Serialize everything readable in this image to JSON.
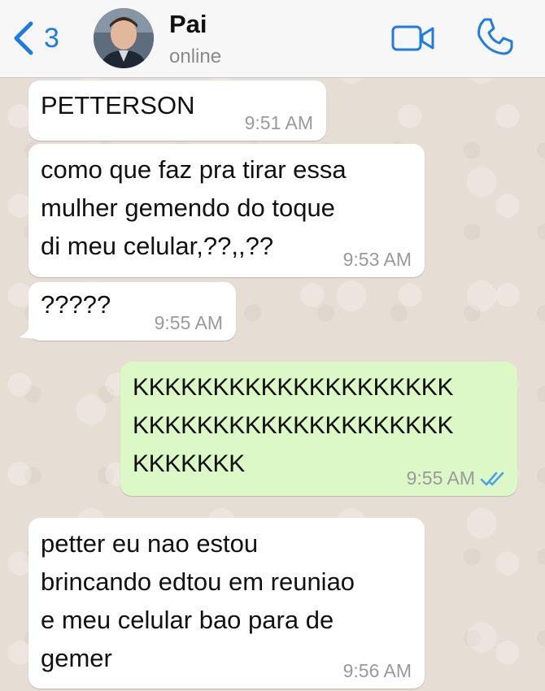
{
  "header": {
    "back_count": "3",
    "contact_name": "Pai",
    "contact_status": "online"
  },
  "messages": [
    {
      "direction": "incoming",
      "text": "PETTERSON",
      "time": "9:51 AM"
    },
    {
      "direction": "incoming",
      "text": "como que faz pra tirar essa\nmulher gemendo do toque\ndi meu celular,??,,??",
      "time": "9:53 AM"
    },
    {
      "direction": "incoming",
      "text": "?????",
      "time": "9:55 AM"
    },
    {
      "direction": "outgoing",
      "text": "KKKKKKKKKKKKKKKKKKKK\nKKKKKKKKKKKKKKKKKKKK\nKKKKKKK",
      "time": "9:55 AM",
      "status": "read"
    },
    {
      "direction": "incoming",
      "text": "petter eu nao estou\nbrincando edtou em reuniao\ne meu celular bao para de\ngemer",
      "time": "9:56 AM"
    }
  ],
  "colors": {
    "accent": "#1f7ae6",
    "incoming_bubble": "#ffffff",
    "outgoing_bubble": "#dcf8c6",
    "read_ticks": "#4aa3e8"
  },
  "icons": [
    "chevron-left-icon",
    "video-camera-icon",
    "phone-icon",
    "double-check-icon"
  ]
}
